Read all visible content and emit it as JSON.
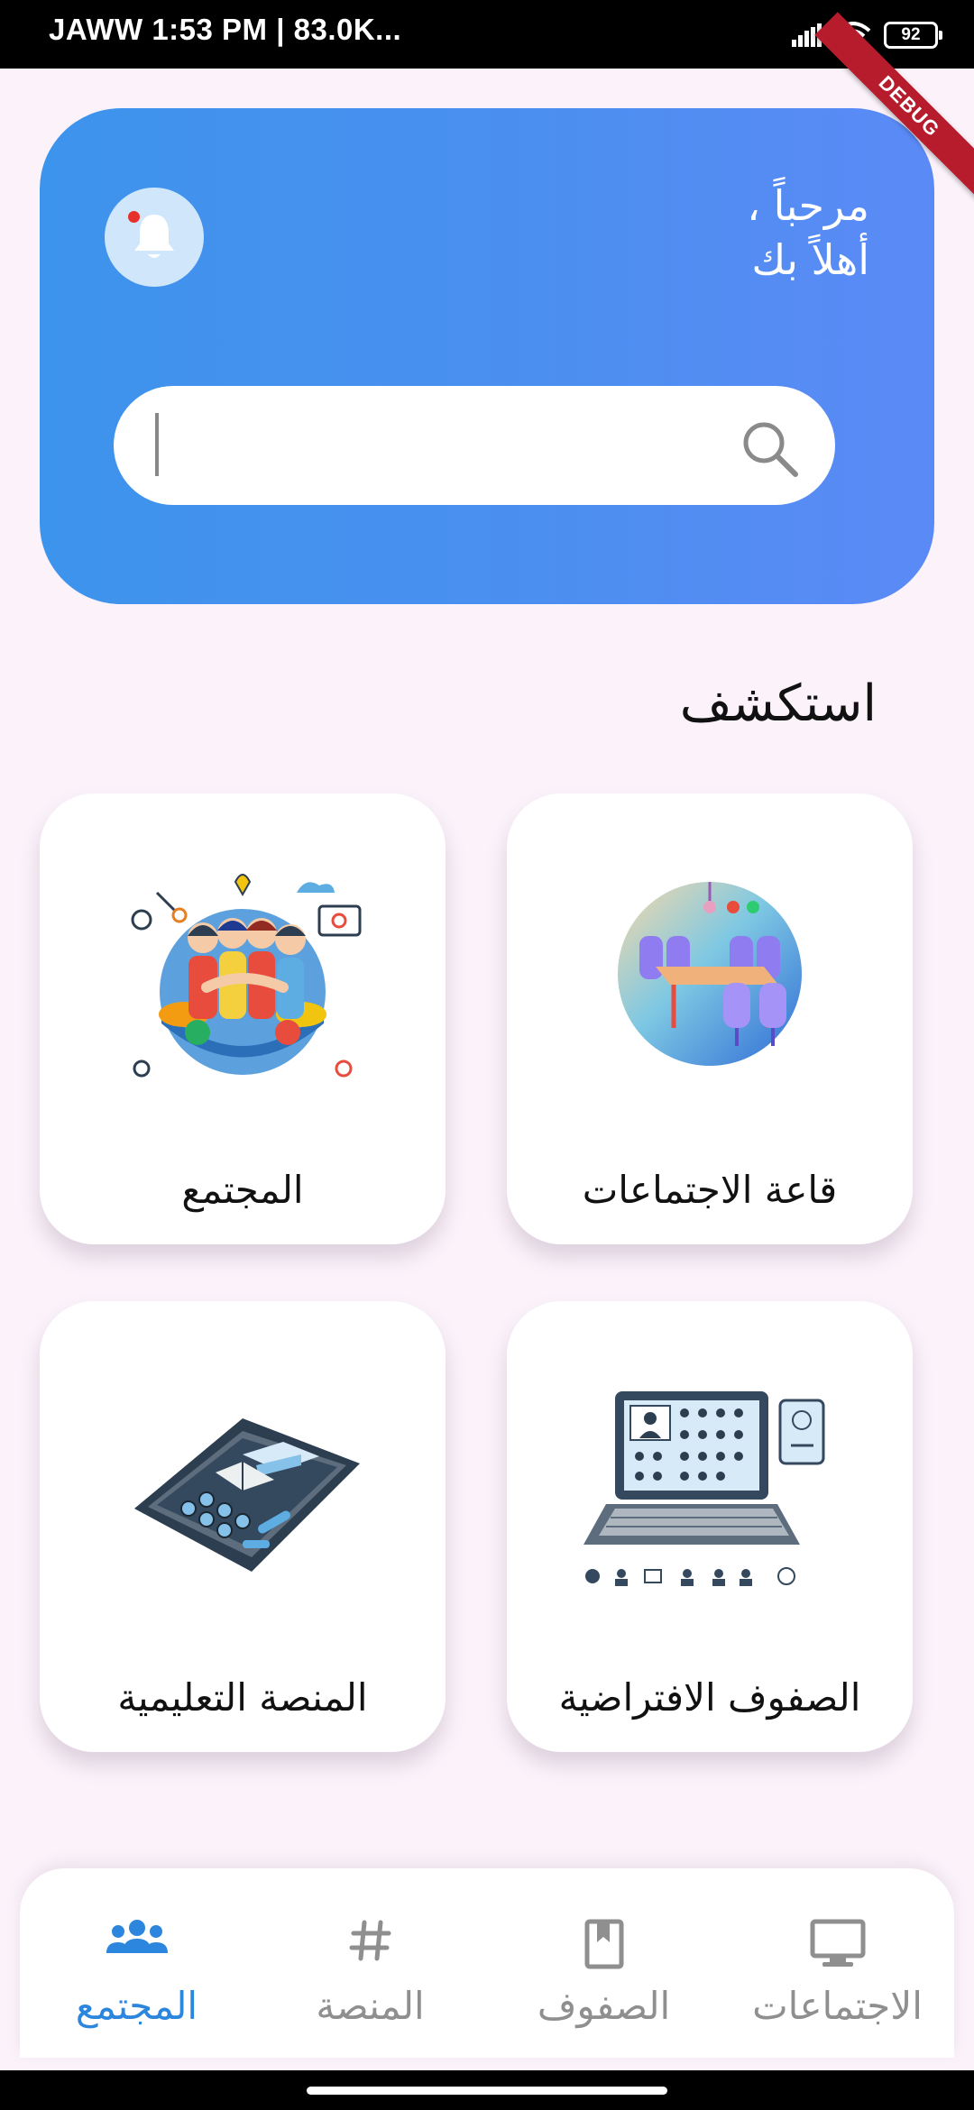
{
  "status_bar": {
    "text": "JAWW⁠ 1:53 PM | 83.0K...",
    "battery": "92"
  },
  "debug_banner": "DEBUG",
  "header": {
    "greeting_line1": "مرحباً ،",
    "greeting_line2": "أهلاً بك",
    "search": {
      "value": "",
      "placeholder": ""
    },
    "notification_dot_color": "#e8302a",
    "gradient": [
      "#3d94ec",
      "#5b8af6"
    ]
  },
  "explore": {
    "title": "استكشف",
    "cards": [
      {
        "label": "المجتمع",
        "icon": "community-illustration"
      },
      {
        "label": "قاعة الاجتماعات",
        "icon": "meeting-room-illustration"
      },
      {
        "label": "المنصة التعليمية",
        "icon": "tablet-education-illustration"
      },
      {
        "label": "الصفوف الافتراضية",
        "icon": "virtual-classroom-illustration"
      }
    ]
  },
  "bottom_nav": {
    "active_color": "#2c86dd",
    "inactive_color": "#8f8f8f",
    "items": [
      {
        "label": "المجتمع",
        "icon": "group-icon",
        "active": true
      },
      {
        "label": "المنصة",
        "icon": "hashtag-icon",
        "active": false
      },
      {
        "label": "الصفوف",
        "icon": "book-icon",
        "active": false
      },
      {
        "label": "الاجتماعات",
        "icon": "monitor-icon",
        "active": false
      }
    ]
  }
}
